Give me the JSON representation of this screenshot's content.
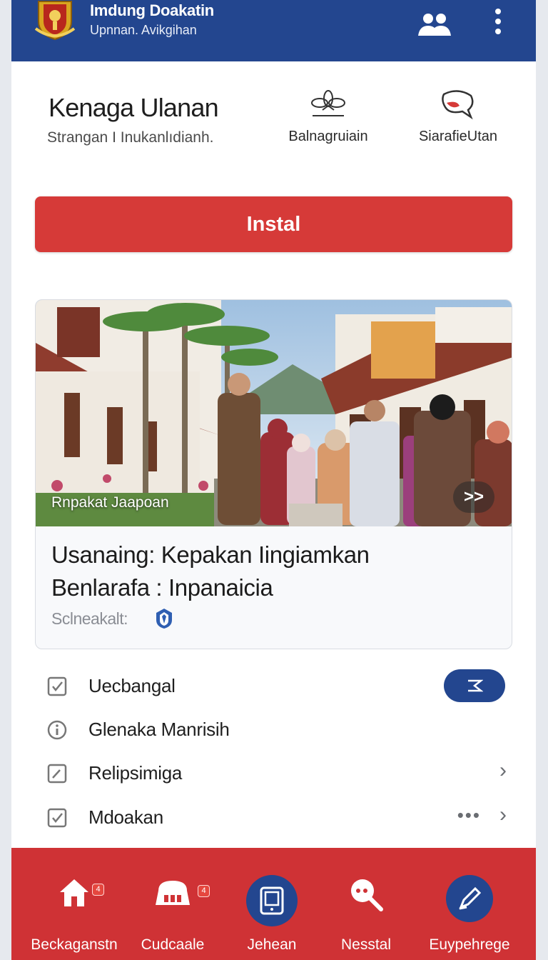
{
  "header": {
    "title": "Imdung Doakatin",
    "subtitle": "Upnnan. Avikgihan"
  },
  "app": {
    "name": "Kenaga Ulanan",
    "description": "Strangan I Inukanlıdianh.",
    "stats": [
      {
        "label": "Balnagruiain",
        "icon": "flower-emblem-icon"
      },
      {
        "label": "SiarafieUtan",
        "icon": "chat-bubble-icon"
      }
    ],
    "install_label": "Instal"
  },
  "article": {
    "image_caption": "Rnpakat Jaapoan",
    "next_label": ">>",
    "title_line1": "Usanaing: Kepakan Iingiamkan",
    "title_line2": "Benlarafa : Inpanaicia",
    "source": "Sclneakalt:"
  },
  "list": [
    {
      "label": "Uecbangal",
      "icon": "checkbox-icon",
      "trailing": "pill"
    },
    {
      "label": "Glenaka Manrisih",
      "icon": "info-icon",
      "trailing": "none"
    },
    {
      "label": "Relipsimiga",
      "icon": "edit-icon",
      "trailing": "chevron"
    },
    {
      "label": "Mdoakan",
      "icon": "checkbox-icon",
      "trailing": "dots-chevron"
    }
  ],
  "bottom_nav": [
    {
      "label": "Beckaganstn",
      "icon": "home-icon",
      "badge": "4"
    },
    {
      "label": "Cudcaale",
      "icon": "shop-icon",
      "badge": "4"
    },
    {
      "label": "Jehean",
      "icon": "tablet-icon",
      "badge": ""
    },
    {
      "label": "Nesstal",
      "icon": "search-icon",
      "badge": ""
    },
    {
      "label": "Euypehrege",
      "icon": "pen-icon",
      "badge": ""
    }
  ],
  "colors": {
    "header": "#23468f",
    "accent_red": "#d63a38",
    "nav_red": "#cf3235"
  }
}
